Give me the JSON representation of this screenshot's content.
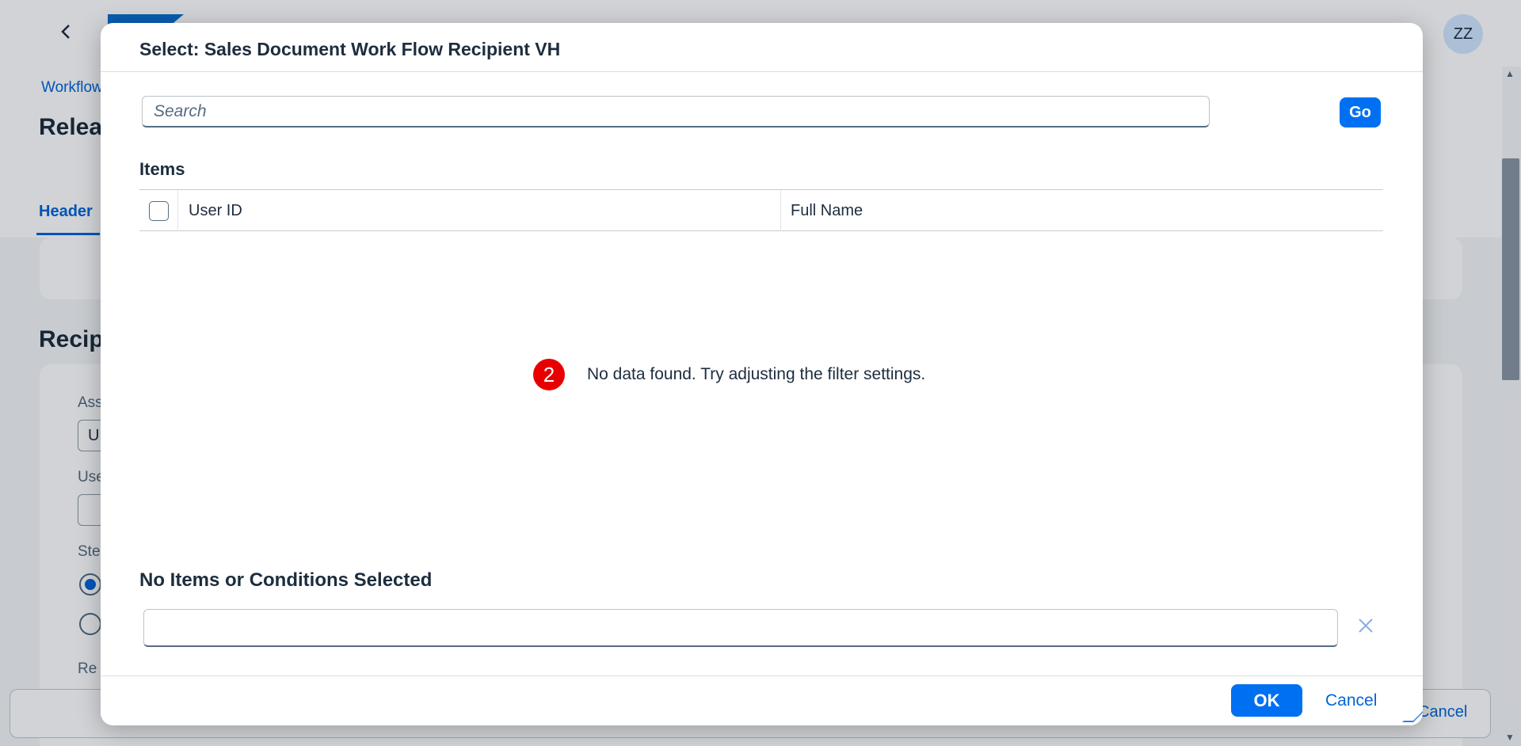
{
  "background": {
    "avatar_initials": "ZZ",
    "breadcrumb": "Workflow",
    "page_title": "Relea",
    "tab_header": "Header",
    "section_title": "Recip",
    "field_label_1": "Ass",
    "field_value_1": "U",
    "field_label_2": "Use",
    "field_label_3": "Ste",
    "field_label_4": "Re",
    "footer_cancel": "Cancel"
  },
  "dialog": {
    "title": "Select: Sales Document Work Flow Recipient VH",
    "search": {
      "placeholder": "Search",
      "value": ""
    },
    "go_label": "Go",
    "items_title": "Items",
    "columns": [
      "User ID",
      "Full Name"
    ],
    "rows": [],
    "empty": {
      "badge": "2",
      "message": "No data found. Try adjusting the filter settings."
    },
    "selection_title": "No Items or Conditions Selected",
    "ok_label": "OK",
    "cancel_label": "Cancel"
  },
  "colors": {
    "accent": "#0070f2",
    "link": "#0064d9",
    "badge": "#e80000"
  },
  "icons": {
    "back": "chevron-left-icon",
    "clear": "clear-icon",
    "resize": "resize-handle-icon"
  }
}
